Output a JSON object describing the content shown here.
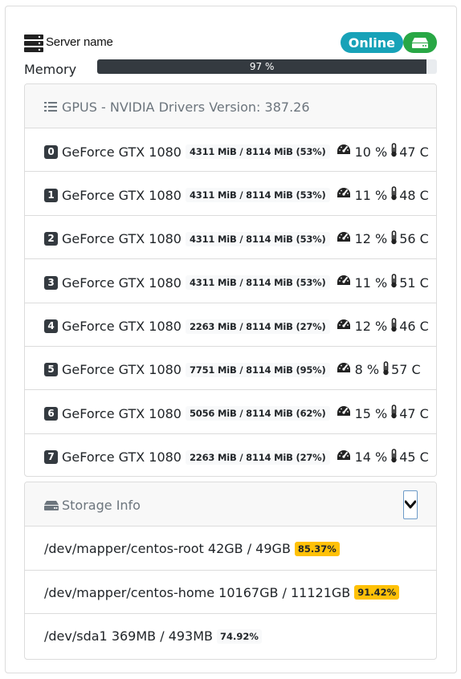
{
  "server": {
    "name": "Server name",
    "status": "Online"
  },
  "memory": {
    "label": "Memory",
    "percent_text": "97 %",
    "percent": 97
  },
  "gpus": {
    "title": "GPUS - NVIDIA Drivers Version: 387.26",
    "items": [
      {
        "index": "0",
        "name": "GeForce GTX 1080",
        "memory": "4311 MiB / 8114 MiB (53%)",
        "util": "10 %",
        "temp": "47 C"
      },
      {
        "index": "1",
        "name": "GeForce GTX 1080",
        "memory": "4311 MiB / 8114 MiB (53%)",
        "util": "11 %",
        "temp": "48 C"
      },
      {
        "index": "2",
        "name": "GeForce GTX 1080",
        "memory": "4311 MiB / 8114 MiB (53%)",
        "util": "12 %",
        "temp": "56 C"
      },
      {
        "index": "3",
        "name": "GeForce GTX 1080",
        "memory": "4311 MiB / 8114 MiB (53%)",
        "util": "11 %",
        "temp": "51 C"
      },
      {
        "index": "4",
        "name": "GeForce GTX 1080",
        "memory": "2263 MiB / 8114 MiB (27%)",
        "util": "12 %",
        "temp": "46 C"
      },
      {
        "index": "5",
        "name": "GeForce GTX 1080",
        "memory": "7751 MiB / 8114 MiB (95%)",
        "util": "8 %",
        "temp": "57 C"
      },
      {
        "index": "6",
        "name": "GeForce GTX 1080",
        "memory": "5056 MiB / 8114 MiB (62%)",
        "util": "15 %",
        "temp": "47 C"
      },
      {
        "index": "7",
        "name": "GeForce GTX 1080",
        "memory": "2263 MiB / 8114 MiB (27%)",
        "util": "14 %",
        "temp": "45 C"
      }
    ]
  },
  "storage": {
    "title": "Storage Info",
    "items": [
      {
        "text": "/dev/mapper/centos-root 42GB / 49GB",
        "percent": "85.37%",
        "level": "warn"
      },
      {
        "text": "/dev/mapper/centos-home 10167GB / 11121GB",
        "percent": "91.42%",
        "level": "warn"
      },
      {
        "text": "/dev/sda1 369MB / 493MB",
        "percent": "74.92%",
        "level": "light"
      }
    ]
  },
  "icons": {
    "server": "server-icon",
    "drive": "hdd-icon",
    "list": "list-icon",
    "gauge": "tachometer-icon",
    "thermometer": "thermometer-icon",
    "chevron": "chevron-down-icon"
  },
  "colors": {
    "online": "#17a2b8",
    "drive": "#28a745",
    "progress": "#343a40",
    "warning": "#ffc107"
  }
}
